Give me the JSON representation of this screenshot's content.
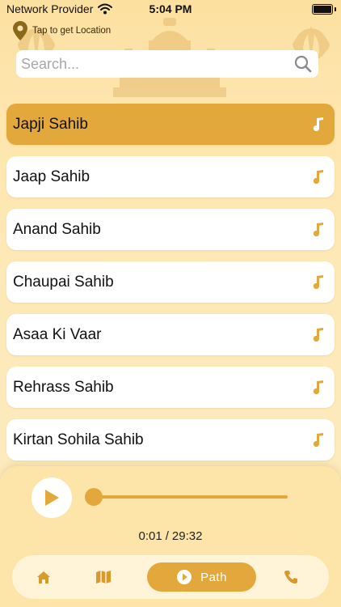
{
  "status_bar": {
    "carrier": "Network Provider",
    "time": "5:04 PM"
  },
  "location": {
    "label": "Tap to get Location",
    "icon": "map-pin-icon"
  },
  "search": {
    "placeholder": "Search...",
    "icon": "search-icon"
  },
  "list": {
    "items": [
      {
        "label": "Japji Sahib",
        "active": true
      },
      {
        "label": "Jaap Sahib",
        "active": false
      },
      {
        "label": "Anand Sahib",
        "active": false
      },
      {
        "label": "Chaupai Sahib",
        "active": false
      },
      {
        "label": "Asaa Ki Vaar",
        "active": false
      },
      {
        "label": "Rehrass Sahib",
        "active": false
      },
      {
        "label": "Kirtan Sohila Sahib",
        "active": false
      }
    ],
    "item_icon": "music-note-icon"
  },
  "player": {
    "current_time": "0:01",
    "separator": "/",
    "total_time": "29:32",
    "progress": 0.0006
  },
  "nav": {
    "items": [
      {
        "icon": "home-icon"
      },
      {
        "icon": "map-icon"
      },
      {
        "icon": "play-circle-icon",
        "label": "Path",
        "active": true
      },
      {
        "icon": "phone-icon"
      }
    ]
  },
  "colors": {
    "accent": "#e3a83b",
    "background": "#fde8b6",
    "card": "#ffffff"
  }
}
